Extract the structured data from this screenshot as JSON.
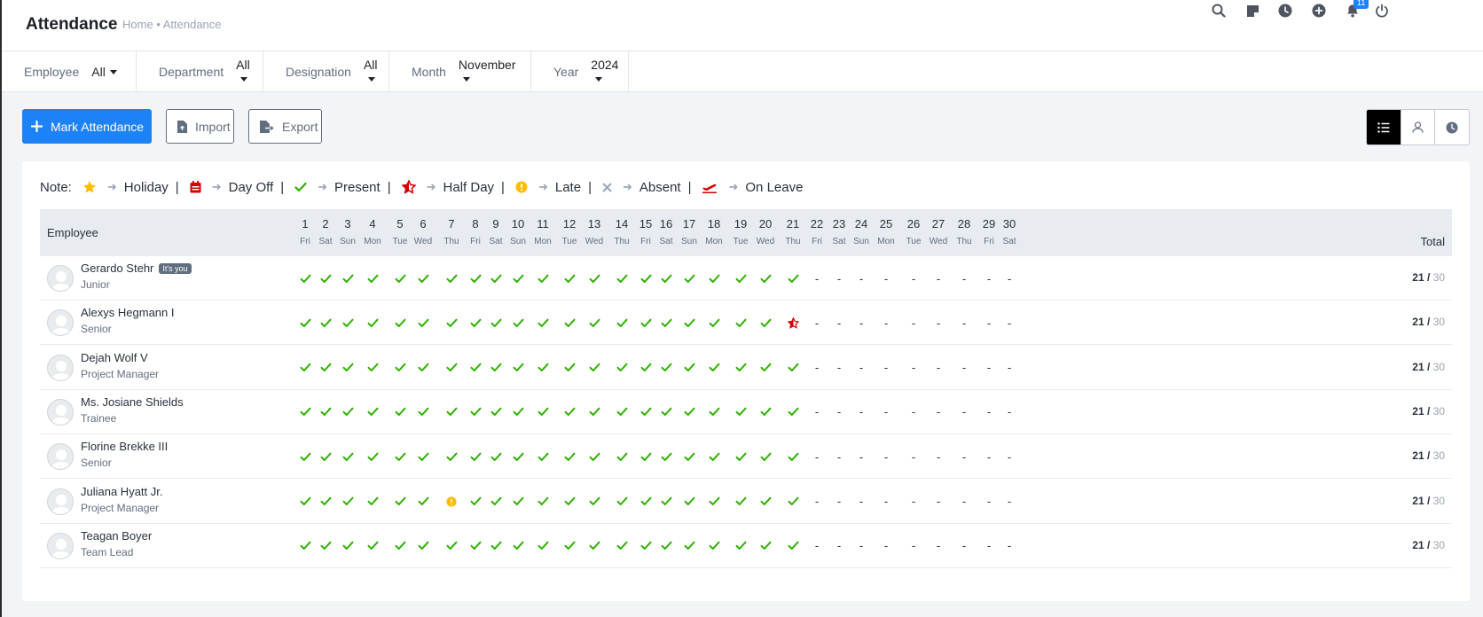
{
  "header": {
    "title": "Attendance",
    "breadcrumb": "Home • Attendance",
    "notification_count": "11"
  },
  "filters": [
    {
      "label": "Employee",
      "value": "All"
    },
    {
      "label": "Department",
      "value": "All"
    },
    {
      "label": "Designation",
      "value": "All"
    },
    {
      "label": "Month",
      "value": "November"
    },
    {
      "label": "Year",
      "value": "2024"
    }
  ],
  "actions": {
    "mark_attendance": "Mark Attendance",
    "import": "Import",
    "export": "Export"
  },
  "legend": {
    "note_label": "Note:",
    "holiday": "Holiday",
    "day_off": "Day Off",
    "present": "Present",
    "half_day": "Half Day",
    "late": "Late",
    "absent": "Absent",
    "on_leave": "On Leave"
  },
  "colors": {
    "accent": "#1d82f5",
    "present": "#2cb100",
    "half_day": "#d30000",
    "late": "#fcbd01",
    "holiday": "#fcbd01",
    "absent": "#99a5b5"
  },
  "table": {
    "employee_header": "Employee",
    "total_header": "Total",
    "days": [
      {
        "num": "1",
        "name": "Fri"
      },
      {
        "num": "2",
        "name": "Sat"
      },
      {
        "num": "3",
        "name": "Sun"
      },
      {
        "num": "4",
        "name": "Mon"
      },
      {
        "num": "5",
        "name": "Tue"
      },
      {
        "num": "6",
        "name": "Wed"
      },
      {
        "num": "7",
        "name": "Thu"
      },
      {
        "num": "8",
        "name": "Fri"
      },
      {
        "num": "9",
        "name": "Sat"
      },
      {
        "num": "10",
        "name": "Sun"
      },
      {
        "num": "11",
        "name": "Mon"
      },
      {
        "num": "12",
        "name": "Tue"
      },
      {
        "num": "13",
        "name": "Wed"
      },
      {
        "num": "14",
        "name": "Thu"
      },
      {
        "num": "15",
        "name": "Fri"
      },
      {
        "num": "16",
        "name": "Sat"
      },
      {
        "num": "17",
        "name": "Sun"
      },
      {
        "num": "18",
        "name": "Mon"
      },
      {
        "num": "19",
        "name": "Tue"
      },
      {
        "num": "20",
        "name": "Wed"
      },
      {
        "num": "21",
        "name": "Thu"
      },
      {
        "num": "22",
        "name": "Fri"
      },
      {
        "num": "23",
        "name": "Sat"
      },
      {
        "num": "24",
        "name": "Sun"
      },
      {
        "num": "25",
        "name": "Mon"
      },
      {
        "num": "26",
        "name": "Tue"
      },
      {
        "num": "27",
        "name": "Wed"
      },
      {
        "num": "28",
        "name": "Thu"
      },
      {
        "num": "29",
        "name": "Fri"
      },
      {
        "num": "30",
        "name": "Sat"
      }
    ],
    "dash_text": "-",
    "employees": [
      {
        "name": "Gerardo Stehr",
        "badge": "It's you",
        "designation": "Junior",
        "total": "21",
        "max": "30",
        "status": [
          "P",
          "P",
          "P",
          "P",
          "P",
          "P",
          "P",
          "P",
          "P",
          "P",
          "P",
          "P",
          "P",
          "P",
          "P",
          "P",
          "P",
          "P",
          "P",
          "P",
          "P",
          "-",
          "-",
          "-",
          "-",
          "-",
          "-",
          "-",
          "-",
          "-"
        ]
      },
      {
        "name": "Alexys Hegmann I",
        "badge": "",
        "designation": "Senior",
        "total": "21",
        "max": "30",
        "status": [
          "P",
          "P",
          "P",
          "P",
          "P",
          "P",
          "P",
          "P",
          "P",
          "P",
          "P",
          "P",
          "P",
          "P",
          "P",
          "P",
          "P",
          "P",
          "P",
          "P",
          "H",
          "-",
          "-",
          "-",
          "-",
          "-",
          "-",
          "-",
          "-",
          "-"
        ]
      },
      {
        "name": "Dejah Wolf V",
        "badge": "",
        "designation": "Project Manager",
        "total": "21",
        "max": "30",
        "status": [
          "P",
          "P",
          "P",
          "P",
          "P",
          "P",
          "P",
          "P",
          "P",
          "P",
          "P",
          "P",
          "P",
          "P",
          "P",
          "P",
          "P",
          "P",
          "P",
          "P",
          "P",
          "-",
          "-",
          "-",
          "-",
          "-",
          "-",
          "-",
          "-",
          "-"
        ]
      },
      {
        "name": "Ms. Josiane Shields",
        "badge": "",
        "designation": "Trainee",
        "total": "21",
        "max": "30",
        "status": [
          "P",
          "P",
          "P",
          "P",
          "P",
          "P",
          "P",
          "P",
          "P",
          "P",
          "P",
          "P",
          "P",
          "P",
          "P",
          "P",
          "P",
          "P",
          "P",
          "P",
          "P",
          "-",
          "-",
          "-",
          "-",
          "-",
          "-",
          "-",
          "-",
          "-"
        ]
      },
      {
        "name": "Florine Brekke III",
        "badge": "",
        "designation": "Senior",
        "total": "21",
        "max": "30",
        "status": [
          "P",
          "P",
          "P",
          "P",
          "P",
          "P",
          "P",
          "P",
          "P",
          "P",
          "P",
          "P",
          "P",
          "P",
          "P",
          "P",
          "P",
          "P",
          "P",
          "P",
          "P",
          "-",
          "-",
          "-",
          "-",
          "-",
          "-",
          "-",
          "-",
          "-"
        ]
      },
      {
        "name": "Juliana Hyatt Jr.",
        "badge": "",
        "designation": "Project Manager",
        "total": "21",
        "max": "30",
        "status": [
          "P",
          "P",
          "P",
          "P",
          "P",
          "P",
          "L",
          "P",
          "P",
          "P",
          "P",
          "P",
          "P",
          "P",
          "P",
          "P",
          "P",
          "P",
          "P",
          "P",
          "P",
          "-",
          "-",
          "-",
          "-",
          "-",
          "-",
          "-",
          "-",
          "-"
        ]
      },
      {
        "name": "Teagan Boyer",
        "badge": "",
        "designation": "Team Lead",
        "total": "21",
        "max": "30",
        "status": [
          "P",
          "P",
          "P",
          "P",
          "P",
          "P",
          "P",
          "P",
          "P",
          "P",
          "P",
          "P",
          "P",
          "P",
          "P",
          "P",
          "P",
          "P",
          "P",
          "P",
          "P",
          "-",
          "-",
          "-",
          "-",
          "-",
          "-",
          "-",
          "-",
          "-"
        ]
      }
    ]
  }
}
